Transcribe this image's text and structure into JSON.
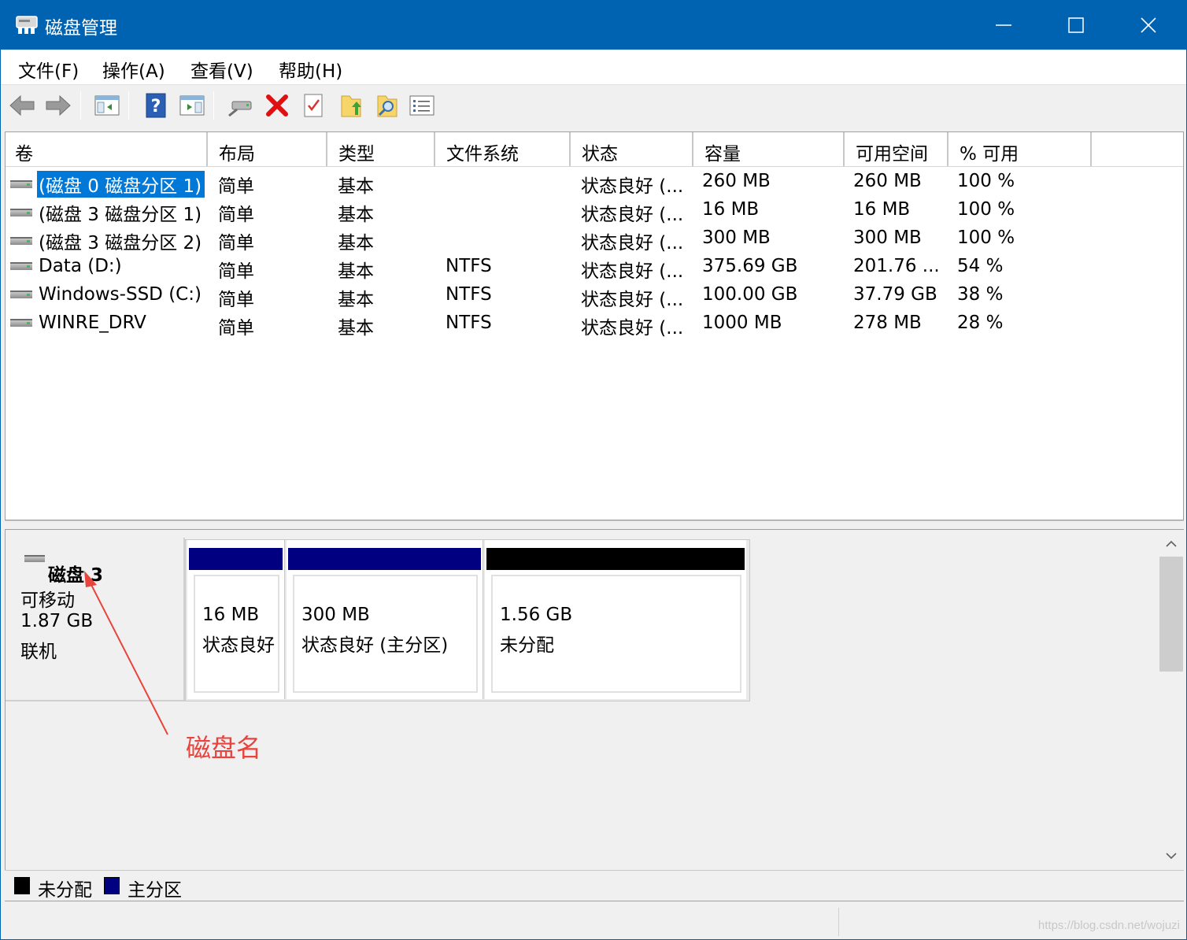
{
  "window": {
    "title": "磁盘管理",
    "controls": {
      "minimize": "minimize-icon",
      "maximize": "maximize-icon",
      "close": "close-icon"
    }
  },
  "menu": [
    "文件(F)",
    "操作(A)",
    "查看(V)",
    "帮助(H)"
  ],
  "toolbar": {
    "buttons": [
      "back-arrow-icon",
      "forward-arrow-icon",
      "console-tree-icon",
      "help-icon",
      "action-pane-icon",
      "connect-disk-icon",
      "delete-icon",
      "properties-icon",
      "folder-up-icon",
      "explore-icon",
      "list-view-icon"
    ]
  },
  "volume_list": {
    "columns": [
      "卷",
      "布局",
      "类型",
      "文件系统",
      "状态",
      "容量",
      "可用空间",
      "% 可用"
    ],
    "rows": [
      {
        "volume": "(磁盘 0 磁盘分区 1)",
        "layout": "简单",
        "type": "基本",
        "fs": "",
        "status": "状态良好 (...",
        "capacity": "260 MB",
        "free": "260 MB",
        "pct": "100 %",
        "selected": true
      },
      {
        "volume": "(磁盘 3 磁盘分区 1)",
        "layout": "简单",
        "type": "基本",
        "fs": "",
        "status": "状态良好 (...",
        "capacity": "16 MB",
        "free": "16 MB",
        "pct": "100 %",
        "selected": false
      },
      {
        "volume": "(磁盘 3 磁盘分区 2)",
        "layout": "简单",
        "type": "基本",
        "fs": "",
        "status": "状态良好 (...",
        "capacity": "300 MB",
        "free": "300 MB",
        "pct": "100 %",
        "selected": false
      },
      {
        "volume": "Data (D:)",
        "layout": "简单",
        "type": "基本",
        "fs": "NTFS",
        "status": "状态良好 (...",
        "capacity": "375.69 GB",
        "free": "201.76 ...",
        "pct": "54 %",
        "selected": false
      },
      {
        "volume": "Windows-SSD (C:)",
        "layout": "简单",
        "type": "基本",
        "fs": "NTFS",
        "status": "状态良好 (...",
        "capacity": "100.00 GB",
        "free": "37.79 GB",
        "pct": "38 %",
        "selected": false
      },
      {
        "volume": "WINRE_DRV",
        "layout": "简单",
        "type": "基本",
        "fs": "NTFS",
        "status": "状态良好 (...",
        "capacity": "1000 MB",
        "free": "278 MB",
        "pct": "28 %",
        "selected": false
      }
    ]
  },
  "disk": {
    "name": "磁盘 3",
    "kind": "可移动",
    "size": "1.87 GB",
    "state": "联机",
    "partitions": [
      {
        "size": "16 MB",
        "status": "状态良好",
        "bar_color": "#000080"
      },
      {
        "size": "300 MB",
        "status": "状态良好 (主分区)",
        "bar_color": "#000080"
      },
      {
        "size": "1.56 GB",
        "status": "未分配",
        "bar_color": "#000000"
      }
    ]
  },
  "annotation": {
    "label": "磁盘名",
    "color": "#e8433c"
  },
  "legend": [
    {
      "label": "未分配",
      "color": "#000000"
    },
    {
      "label": "主分区",
      "color": "#000080"
    }
  ],
  "statusbar": {
    "watermark": "https://blog.csdn.net/wojuzi"
  }
}
